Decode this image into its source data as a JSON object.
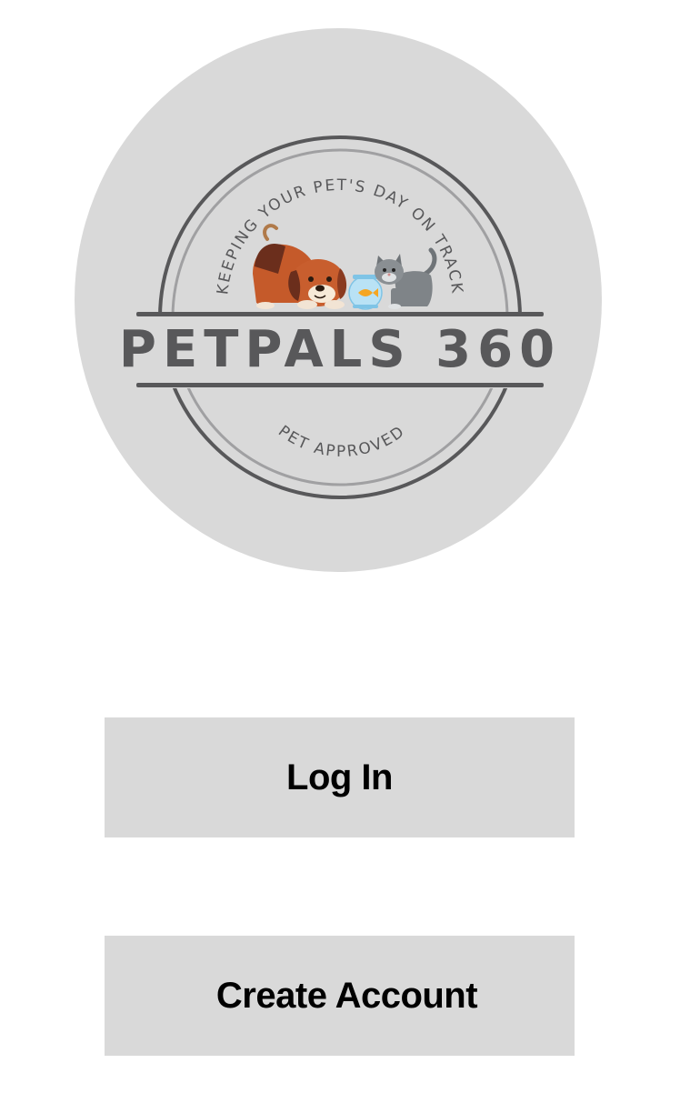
{
  "logo": {
    "tagline": "KEEPING YOUR PET'S DAY ON TRACK",
    "brand": "PETPALS 360",
    "seal": "PET APPROVED",
    "icons": [
      "dog-icon",
      "fishbowl-icon",
      "cat-icon"
    ]
  },
  "actions": {
    "login_label": "Log In",
    "create_account_label": "Create Account"
  },
  "colors": {
    "logo_background": "#d9d9d9",
    "logo_ink": "#58585a",
    "button_background": "#d9d9d9",
    "button_text": "#000000"
  }
}
